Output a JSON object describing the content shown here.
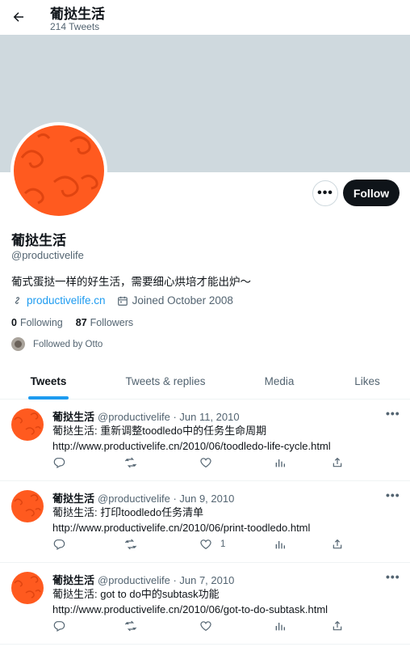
{
  "header": {
    "title": "葡挞生活",
    "subtitle": "214 Tweets"
  },
  "profile": {
    "name": "葡挞生活",
    "handle": "@productivelife",
    "bio": "葡式蛋挞一样的好生活，需要细心烘培才能出炉～",
    "website": "productivelife.cn",
    "joined": "Joined October 2008",
    "following_count": "0",
    "following_label": "Following",
    "followers_count": "87",
    "followers_label": "Followers",
    "followed_by": "Followed by Otto",
    "follow_button": "Follow",
    "more_button": "•••"
  },
  "tabs": [
    {
      "label": "Tweets",
      "active": true
    },
    {
      "label": "Tweets & replies",
      "active": false
    },
    {
      "label": "Media",
      "active": false
    },
    {
      "label": "Likes",
      "active": false
    }
  ],
  "tweets": [
    {
      "name": "葡挞生活",
      "handle": "@productivelife",
      "date": "· Jun 11, 2010",
      "line1": "葡挞生活: 重新调整toodledo中的任务生命周期",
      "line2": "http://www.productivelife.cn/2010/06/toodledo-life-cycle.html",
      "likes": ""
    },
    {
      "name": "葡挞生活",
      "handle": "@productivelife",
      "date": "· Jun 9, 2010",
      "line1": "葡挞生活: 打印toodledo任务清单",
      "line2": "http://www.productivelife.cn/2010/06/print-toodledo.html",
      "likes": "1"
    },
    {
      "name": "葡挞生活",
      "handle": "@productivelife",
      "date": "· Jun 7, 2010",
      "line1": "葡挞生活: got to do中的subtask功能",
      "line2": "http://www.productivelife.cn/2010/06/got-to-do-subtask.html",
      "likes": ""
    }
  ],
  "icons": {
    "back": "arrow-left-icon",
    "link": "link-icon",
    "calendar": "calendar-icon",
    "reply": "reply-icon",
    "retweet": "retweet-icon",
    "like": "heart-icon",
    "views": "views-icon",
    "share": "share-icon"
  },
  "colors": {
    "accent": "#1d9bf0",
    "avatar": "#ff5a1f",
    "banner": "#cfd9de",
    "follow_bg": "#0f1419"
  }
}
